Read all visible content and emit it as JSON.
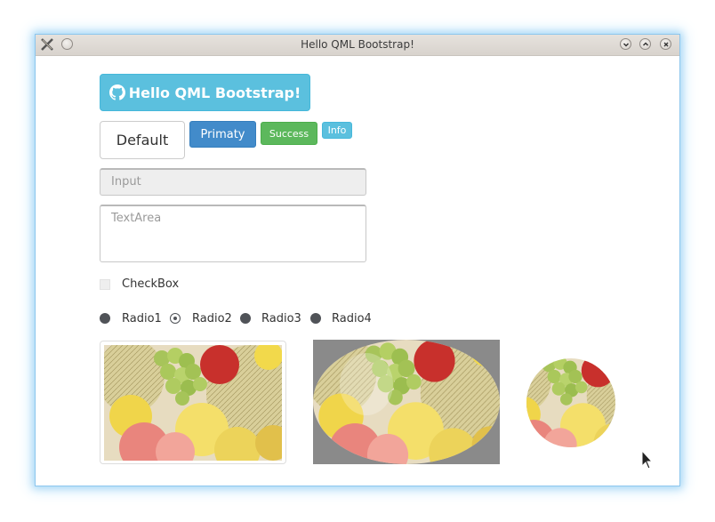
{
  "window": {
    "title": "Hello QML Bootstrap!"
  },
  "buttons": {
    "hello_label": "Hello QML Bootstrap!",
    "hello_icon": "github-icon",
    "default_label": "Default",
    "primary_label": "Primaty",
    "success_label": "Success",
    "info_label": "Info"
  },
  "inputs": {
    "input_placeholder": "Input",
    "textarea_placeholder": "TextArea"
  },
  "checkbox": {
    "label": "CheckBox",
    "checked": false
  },
  "radios": [
    {
      "label": "Radio1",
      "checked": false
    },
    {
      "label": "Radio2",
      "checked": true
    },
    {
      "label": "Radio3",
      "checked": false
    },
    {
      "label": "Radio4",
      "checked": false
    }
  ],
  "images": [
    {
      "name": "fruit-image-rounded",
      "style": "rounded"
    },
    {
      "name": "fruit-image-ellipse",
      "style": "ellipse"
    },
    {
      "name": "fruit-image-circle",
      "style": "circle"
    }
  ],
  "colors": {
    "info": "#5bc0de",
    "primary": "#428bca",
    "success": "#5cb85c"
  }
}
